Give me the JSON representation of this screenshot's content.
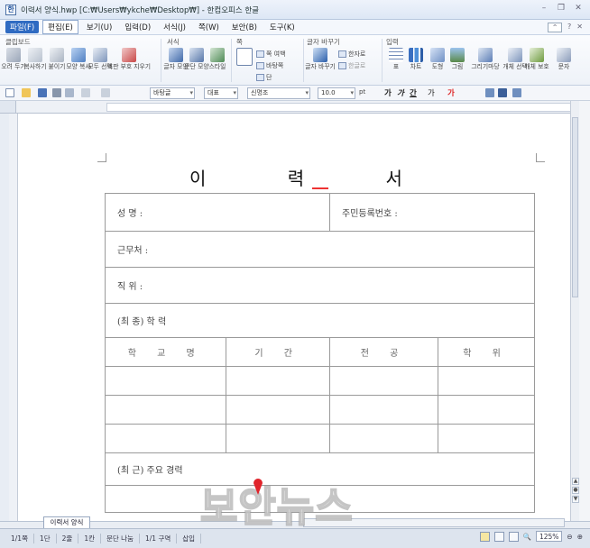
{
  "window": {
    "title": "이력서 양식.hwp [C:₩Users₩ykche₩Desktop₩] - 한컴오피스 한글"
  },
  "menu": {
    "items": [
      "파일(F)",
      "편집(E)",
      "보기(U)",
      "입력(D)",
      "서식(J)",
      "쪽(W)",
      "보안(B)",
      "도구(K)"
    ]
  },
  "ribbon": {
    "groups": [
      "클립보드",
      "서식",
      "쪽",
      "글자 바꾸기",
      "입력"
    ],
    "clipboard": [
      "오려 두기",
      "복사하기",
      "붙이기",
      "모양 복사",
      "모두 선택",
      "조판 부호 지우기"
    ],
    "format": [
      "글자 모양",
      "문단 모양",
      "스타일"
    ],
    "page": [
      "쪽 여백",
      "바탕쪽",
      "단"
    ],
    "change": [
      "글자 바꾸기",
      "한자로",
      "한글로"
    ],
    "insert": [
      "표",
      "차트",
      "도형",
      "그림",
      "그리기마당",
      "개체 선택",
      "개체 보호"
    ],
    "extra": "문자"
  },
  "format_toolbar": {
    "style": "바탕글",
    "lang": "대표",
    "font": "신명조",
    "size": "10.0",
    "unit": "pt",
    "buttons": [
      "가",
      "가",
      "간",
      "가",
      "가"
    ]
  },
  "document": {
    "title": "이 력 서",
    "rows": {
      "name": "성  명 :",
      "ssn": "주민등록번호 :",
      "workplace": "근무처 :",
      "position": "직  위 :",
      "education": "(최 종) 학   력",
      "career": "(최 근) 주요 경력"
    },
    "edu_headers": [
      "학 교 명",
      "기 간",
      "전 공",
      "학 위"
    ]
  },
  "tabs": {
    "doc_tab": "이력서 양식"
  },
  "status": {
    "page": "1/1쪽",
    "section": "1단",
    "line": "2줄",
    "column": "1칸",
    "wrap": "문단 나눔",
    "area": "1/1 구역",
    "mode": "삽입",
    "zoom": "125%"
  },
  "watermark": {
    "text": "보안뉴스"
  }
}
